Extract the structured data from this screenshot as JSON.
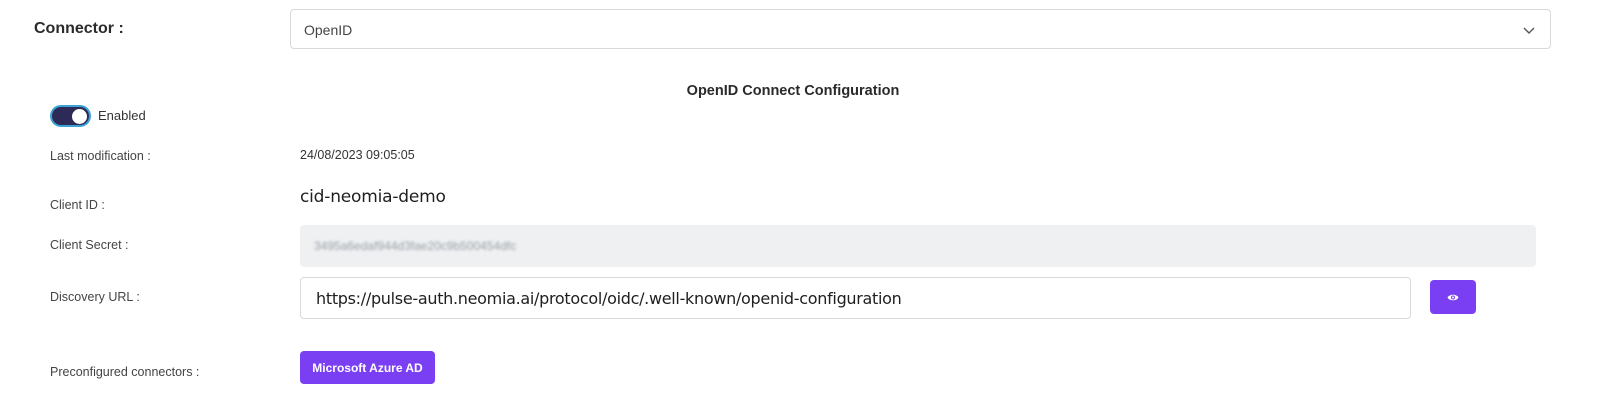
{
  "connector": {
    "label": "Connector :",
    "selected": "OpenID"
  },
  "section": {
    "title": "OpenID Connect Configuration"
  },
  "enabled": {
    "label": "Enabled",
    "state": true
  },
  "last_modification": {
    "label": "Last modification :",
    "value": "24/08/2023 09:05:05"
  },
  "client_id": {
    "label": "Client ID :",
    "value": "cid-neomia-demo"
  },
  "client_secret": {
    "label": "Client Secret :",
    "value": "3495a6edaf944d3fae20c9b500454dfc"
  },
  "discovery_url": {
    "label": "Discovery URL :",
    "value": "https://pulse-auth.neomia.ai/protocol/oidc/.well-known/openid-configuration"
  },
  "preconfigured": {
    "label": "Preconfigured connectors :",
    "button_label": "Microsoft Azure AD"
  },
  "colors": {
    "accent": "#7a3ff2",
    "toggle_on": "#2e2a57"
  }
}
